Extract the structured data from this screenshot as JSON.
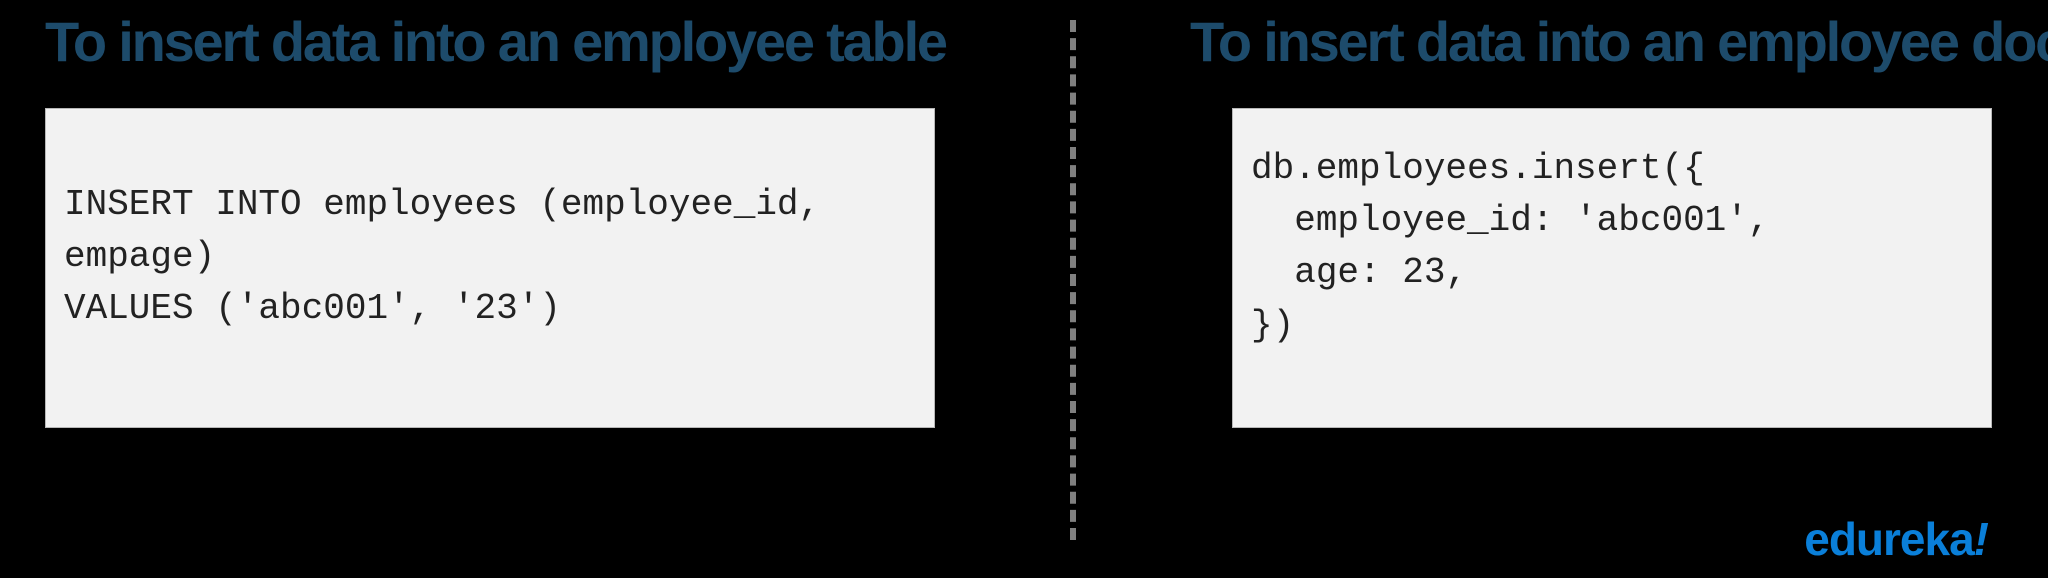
{
  "left": {
    "heading": "To insert data into an employee table",
    "code": "INSERT INTO employees (employee_id, empage)\nVALUES ('abc001', '23')"
  },
  "right": {
    "heading": "To insert data into an employee document",
    "code": "db.employees.insert({\n  employee_id: 'abc001',\n  age: 23,\n})"
  },
  "brand": {
    "text": "edureka",
    "punct": "!"
  }
}
